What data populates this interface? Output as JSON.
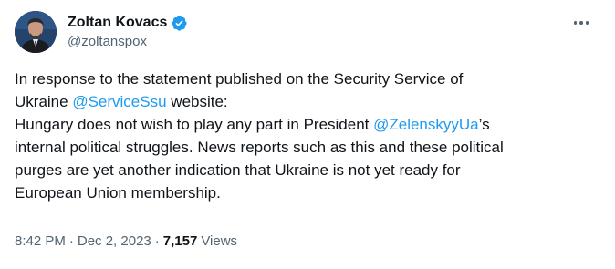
{
  "author": {
    "name": "Zoltan Kovacs",
    "handle": "@zoltanspox",
    "verified_color": "#1d9bf0"
  },
  "tweet": {
    "line1": "In response to the statement published on the Security Service of",
    "line2_prefix": "Ukraine ",
    "mention1": "@ServiceSsu",
    "line2_suffix": " website:",
    "line3_prefix": "Hungary does not wish to play any part in President ",
    "mention2": "@ZelenskyyUa",
    "line3_suffix": "’s",
    "line4": "internal political struggles. News reports such as this and these political",
    "line5": "purges are yet another indication that Ukraine is not yet ready for",
    "line6": "European Union membership."
  },
  "meta": {
    "time": "8:42 PM",
    "separator1": "·",
    "date": "Dec 2, 2023",
    "separator2": "·",
    "views_count": "7,157",
    "views_label": "Views"
  },
  "icons": {
    "more": "more-horizontal-icon",
    "verified": "verified-badge-icon"
  }
}
